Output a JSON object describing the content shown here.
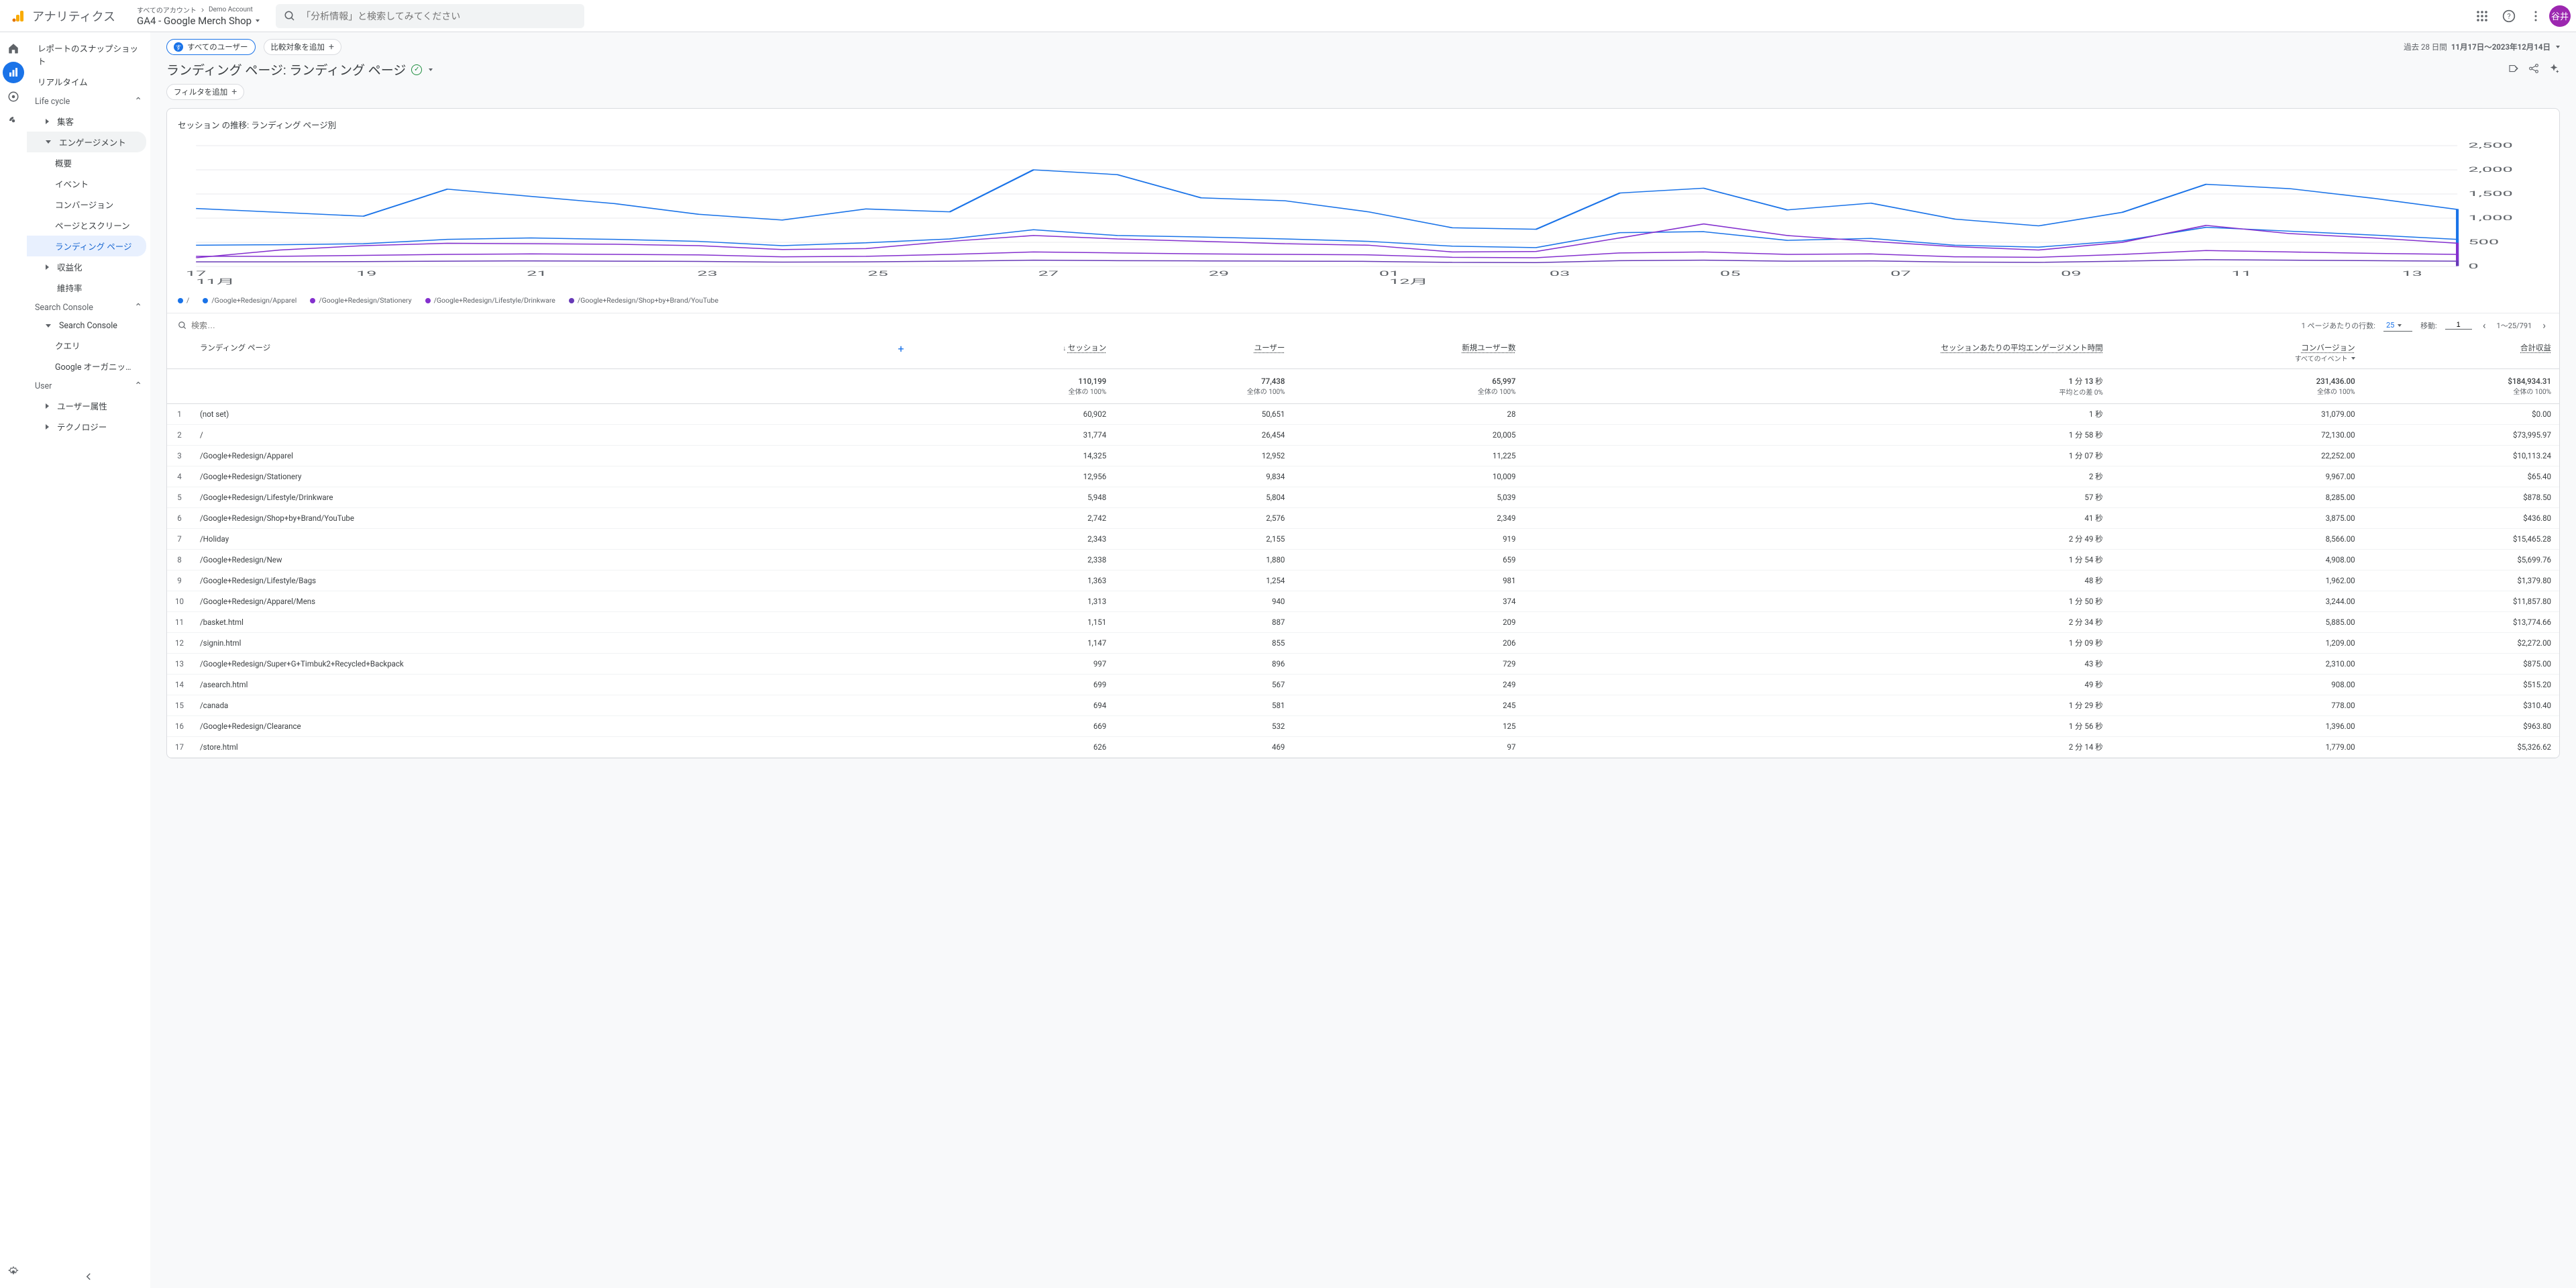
{
  "header": {
    "product": "アナリティクス",
    "account_path1": "すべてのアカウント",
    "account_path2": "Demo Account",
    "property": "GA4 - Google Merch Shop",
    "search_placeholder": "「分析情報」と検索してみてください",
    "avatar": "谷井"
  },
  "nav": {
    "snapshot": "レポートのスナップショット",
    "realtime": "リアルタイム",
    "lifecycle": "Life cycle",
    "acquisition": "集客",
    "engagement": "エンゲージメント",
    "overview": "概要",
    "events": "イベント",
    "conversions": "コンバージョン",
    "pages": "ページとスクリーン",
    "landing": "ランディング ページ",
    "monetization": "収益化",
    "retention": "維持率",
    "search_console_sec": "Search Console",
    "search_console_sub": "Search Console",
    "queries": "クエリ",
    "google_organic": "Google オーガニック検索レ…",
    "user_sec": "User",
    "user_attrs": "ユーザー属性",
    "tech": "テクノロジー"
  },
  "toolbar": {
    "all_users": "すべてのユーザー",
    "add_compare": "比較対象を追加",
    "date_prefix": "過去 28 日間",
    "date_range": "11月17日～2023年12月14日",
    "page_title": "ランディング ページ: ランディング ページ",
    "add_filter": "フィルタを追加"
  },
  "chart": {
    "title": "セッション の推移: ランディング ページ別",
    "y_ticks": [
      "0",
      "500",
      "1,000",
      "1,500",
      "2,000",
      "2,500"
    ],
    "x_ticks": [
      "17",
      "19",
      "21",
      "23",
      "25",
      "27",
      "29",
      "01",
      "03",
      "05",
      "07",
      "09",
      "11",
      "13"
    ],
    "x_sub1": "11月",
    "x_sub2": "12月"
  },
  "chart_data": {
    "type": "line",
    "xlabel": "",
    "ylabel": "",
    "x": [
      17,
      18,
      19,
      20,
      21,
      22,
      23,
      24,
      25,
      26,
      27,
      28,
      29,
      30,
      1,
      2,
      3,
      4,
      5,
      6,
      7,
      8,
      9,
      10,
      11,
      12,
      13,
      14
    ],
    "ylim": [
      0,
      2500
    ],
    "series": [
      {
        "name": "/",
        "color": "#1a73e8",
        "values": [
          1200,
          1120,
          1040,
          1600,
          1450,
          1300,
          1080,
          960,
          1190,
          1130,
          2000,
          1900,
          1420,
          1360,
          1130,
          800,
          770,
          1520,
          1620,
          1170,
          1310,
          980,
          840,
          1120,
          1700,
          1610,
          1410,
          1180
        ]
      },
      {
        "name": "/Google+Redesign/Apparel",
        "color": "#1a73e8",
        "values": [
          440,
          450,
          470,
          560,
          590,
          560,
          520,
          430,
          490,
          570,
          760,
          640,
          610,
          570,
          520,
          420,
          390,
          700,
          720,
          540,
          580,
          440,
          400,
          530,
          810,
          730,
          650,
          560
        ]
      },
      {
        "name": "/Google+Redesign/Stationery",
        "color": "#8430ce",
        "values": [
          180,
          340,
          430,
          480,
          470,
          460,
          430,
          350,
          370,
          520,
          640,
          570,
          520,
          470,
          440,
          300,
          310,
          590,
          880,
          640,
          520,
          410,
          340,
          500,
          850,
          680,
          590,
          480
        ]
      },
      {
        "name": "/Google+Redesign/Lifestyle/Drinkware",
        "color": "#8430ce",
        "values": [
          210,
          210,
          230,
          250,
          260,
          250,
          240,
          200,
          210,
          250,
          300,
          280,
          260,
          250,
          240,
          190,
          180,
          280,
          300,
          250,
          260,
          200,
          190,
          250,
          330,
          300,
          270,
          250
        ]
      },
      {
        "name": "/Google+Redesign/Shop+by+Brand/YouTube",
        "color": "#673ab7",
        "values": [
          95,
          95,
          100,
          110,
          115,
          110,
          105,
          90,
          95,
          110,
          130,
          120,
          115,
          110,
          105,
          85,
          80,
          120,
          130,
          110,
          115,
          90,
          85,
          110,
          140,
          130,
          120,
          110
        ]
      }
    ]
  },
  "table": {
    "search_placeholder": "検索…",
    "rows_label": "1 ページあたりの行数:",
    "rows_value": "25",
    "goto_label": "移動:",
    "goto_value": "1",
    "range_label": "1～25/791",
    "headers": {
      "dimension": "ランディング ページ",
      "sessions": "セッション",
      "users": "ユーザー",
      "new_users": "新規ユーザー数",
      "avg_engagement": "セッションあたりの平均エンゲージメント時間",
      "conversions": "コンバージョン",
      "conv_sub": "すべてのイベント",
      "revenue": "合計収益"
    },
    "totals": {
      "sessions": "110,199",
      "sessions_sub": "全体の 100%",
      "users": "77,438",
      "users_sub": "全体の 100%",
      "new_users": "65,997",
      "new_users_sub": "全体の 100%",
      "avg": "1 分 13 秒",
      "avg_sub": "平均との差 0%",
      "conv": "231,436.00",
      "conv_sub": "全体の 100%",
      "rev": "$184,934.31",
      "rev_sub": "全体の 100%"
    },
    "rows": [
      {
        "i": "1",
        "page": "(not set)",
        "sess": "60,902",
        "users": "50,651",
        "nu": "28",
        "avg": "1 秒",
        "conv": "31,079.00",
        "rev": "$0.00"
      },
      {
        "i": "2",
        "page": "/",
        "sess": "31,774",
        "users": "26,454",
        "nu": "20,005",
        "avg": "1 分 58 秒",
        "conv": "72,130.00",
        "rev": "$73,995.97"
      },
      {
        "i": "3",
        "page": "/Google+Redesign/Apparel",
        "sess": "14,325",
        "users": "12,952",
        "nu": "11,225",
        "avg": "1 分 07 秒",
        "conv": "22,252.00",
        "rev": "$10,113.24"
      },
      {
        "i": "4",
        "page": "/Google+Redesign/Stationery",
        "sess": "12,956",
        "users": "9,834",
        "nu": "10,009",
        "avg": "2 秒",
        "conv": "9,967.00",
        "rev": "$65.40"
      },
      {
        "i": "5",
        "page": "/Google+Redesign/Lifestyle/Drinkware",
        "sess": "5,948",
        "users": "5,804",
        "nu": "5,039",
        "avg": "57 秒",
        "conv": "8,285.00",
        "rev": "$878.50"
      },
      {
        "i": "6",
        "page": "/Google+Redesign/Shop+by+Brand/YouTube",
        "sess": "2,742",
        "users": "2,576",
        "nu": "2,349",
        "avg": "41 秒",
        "conv": "3,875.00",
        "rev": "$436.80"
      },
      {
        "i": "7",
        "page": "/Holiday",
        "sess": "2,343",
        "users": "2,155",
        "nu": "919",
        "avg": "2 分 49 秒",
        "conv": "8,566.00",
        "rev": "$15,465.28"
      },
      {
        "i": "8",
        "page": "/Google+Redesign/New",
        "sess": "2,338",
        "users": "1,880",
        "nu": "659",
        "avg": "1 分 54 秒",
        "conv": "4,908.00",
        "rev": "$5,699.76"
      },
      {
        "i": "9",
        "page": "/Google+Redesign/Lifestyle/Bags",
        "sess": "1,363",
        "users": "1,254",
        "nu": "981",
        "avg": "48 秒",
        "conv": "1,962.00",
        "rev": "$1,379.80"
      },
      {
        "i": "10",
        "page": "/Google+Redesign/Apparel/Mens",
        "sess": "1,313",
        "users": "940",
        "nu": "374",
        "avg": "1 分 50 秒",
        "conv": "3,244.00",
        "rev": "$11,857.80"
      },
      {
        "i": "11",
        "page": "/basket.html",
        "sess": "1,151",
        "users": "887",
        "nu": "209",
        "avg": "2 分 34 秒",
        "conv": "5,885.00",
        "rev": "$13,774.66"
      },
      {
        "i": "12",
        "page": "/signin.html",
        "sess": "1,147",
        "users": "855",
        "nu": "206",
        "avg": "1 分 09 秒",
        "conv": "1,209.00",
        "rev": "$2,272.00"
      },
      {
        "i": "13",
        "page": "/Google+Redesign/Super+G+Timbuk2+Recycled+Backpack",
        "sess": "997",
        "users": "896",
        "nu": "729",
        "avg": "43 秒",
        "conv": "2,310.00",
        "rev": "$875.00"
      },
      {
        "i": "14",
        "page": "/asearch.html",
        "sess": "699",
        "users": "567",
        "nu": "249",
        "avg": "49 秒",
        "conv": "908.00",
        "rev": "$515.20"
      },
      {
        "i": "15",
        "page": "/canada",
        "sess": "694",
        "users": "581",
        "nu": "245",
        "avg": "1 分 29 秒",
        "conv": "778.00",
        "rev": "$310.40"
      },
      {
        "i": "16",
        "page": "/Google+Redesign/Clearance",
        "sess": "669",
        "users": "532",
        "nu": "125",
        "avg": "1 分 56 秒",
        "conv": "1,396.00",
        "rev": "$963.80"
      },
      {
        "i": "17",
        "page": "/store.html",
        "sess": "626",
        "users": "469",
        "nu": "97",
        "avg": "2 分 14 秒",
        "conv": "1,779.00",
        "rev": "$5,326.62"
      }
    ]
  }
}
